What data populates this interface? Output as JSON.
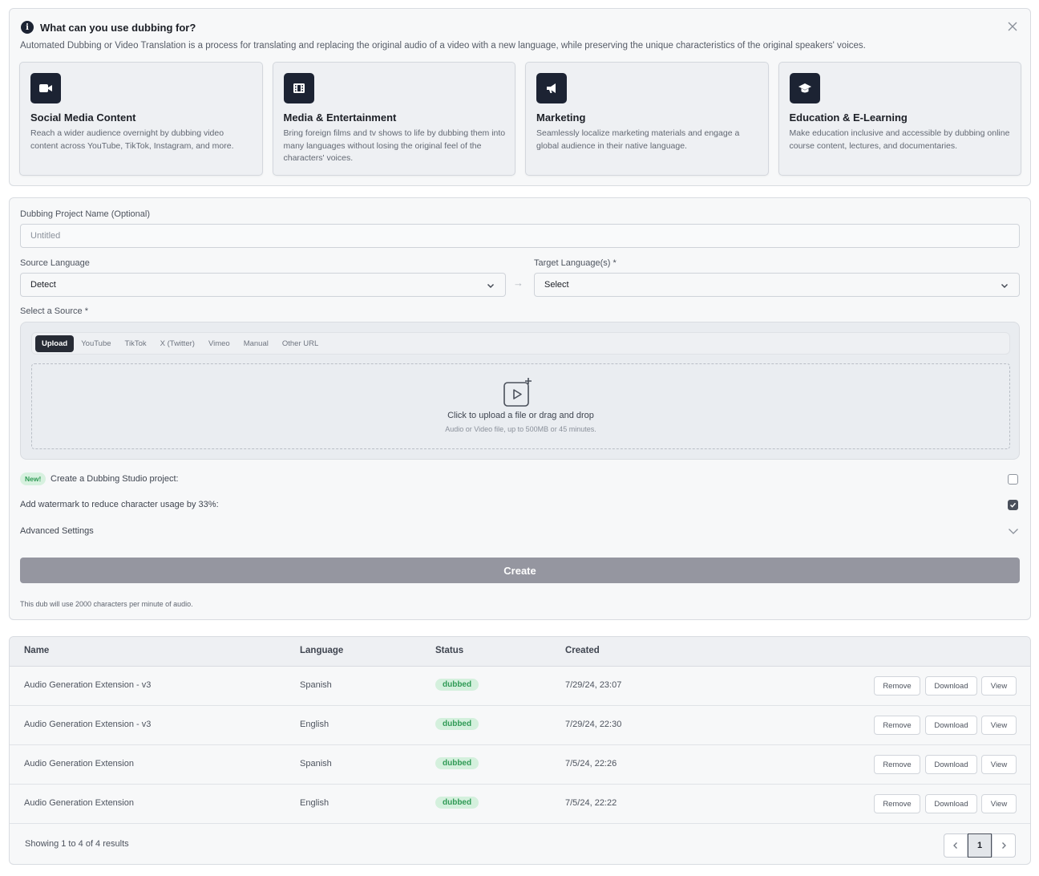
{
  "info": {
    "title": "What can you use dubbing for?",
    "description": "Automated Dubbing or Video Translation is a process for translating and replacing the original audio of a video with a new language, while preserving the unique characteristics of the original speakers' voices.",
    "cards": [
      {
        "icon": "video-camera-icon",
        "title": "Social Media Content",
        "text": "Reach a wider audience overnight by dubbing video content across YouTube, TikTok, Instagram, and more."
      },
      {
        "icon": "film-icon",
        "title": "Media & Entertainment",
        "text": "Bring foreign films and tv shows to life by dubbing them into many languages without losing the original feel of the characters' voices."
      },
      {
        "icon": "megaphone-icon",
        "title": "Marketing",
        "text": "Seamlessly localize marketing materials and engage a global audience in their native language."
      },
      {
        "icon": "graduation-cap-icon",
        "title": "Education & E-Learning",
        "text": "Make education inclusive and accessible by dubbing online course content, lectures, and documentaries."
      }
    ]
  },
  "form": {
    "project_name_label": "Dubbing Project Name (Optional)",
    "project_name_placeholder": "Untitled",
    "source_language_label": "Source Language",
    "source_language_value": "Detect",
    "target_language_label": "Target Language(s) *",
    "target_language_value": "Select",
    "select_source_label": "Select a Source *",
    "tabs": [
      "Upload",
      "YouTube",
      "TikTok",
      "X (Twitter)",
      "Vimeo",
      "Manual",
      "Other URL"
    ],
    "dropzone_title": "Click to upload a file or drag and drop",
    "dropzone_sub": "Audio or Video file, up to 500MB or 45 minutes.",
    "new_badge": "New!",
    "studio_project_label": "Create a Dubbing Studio project:",
    "watermark_label": "Add watermark to reduce character usage by 33%:",
    "advanced_label": "Advanced Settings",
    "create_label": "Create",
    "footnote": "This dub will use 2000 characters per minute of audio.",
    "studio_checked": false,
    "watermark_checked": true
  },
  "table": {
    "headers": [
      "Name",
      "Language",
      "Status",
      "Created"
    ],
    "rows": [
      {
        "name": "Audio Generation Extension - v3",
        "language": "Spanish",
        "status": "dubbed",
        "created": "7/29/24, 23:07"
      },
      {
        "name": "Audio Generation Extension - v3",
        "language": "English",
        "status": "dubbed",
        "created": "7/29/24, 22:30"
      },
      {
        "name": "Audio Generation Extension",
        "language": "Spanish",
        "status": "dubbed",
        "created": "7/5/24, 22:26"
      },
      {
        "name": "Audio Generation Extension",
        "language": "English",
        "status": "dubbed",
        "created": "7/5/24, 22:22"
      }
    ],
    "actions": {
      "remove": "Remove",
      "download": "Download",
      "view": "View"
    },
    "results_text": "Showing 1 to 4 of 4 results",
    "current_page": "1"
  },
  "colors": {
    "dark": "#1c2333",
    "status_green": "#2f9a55",
    "create_disabled": "#9596a0"
  }
}
